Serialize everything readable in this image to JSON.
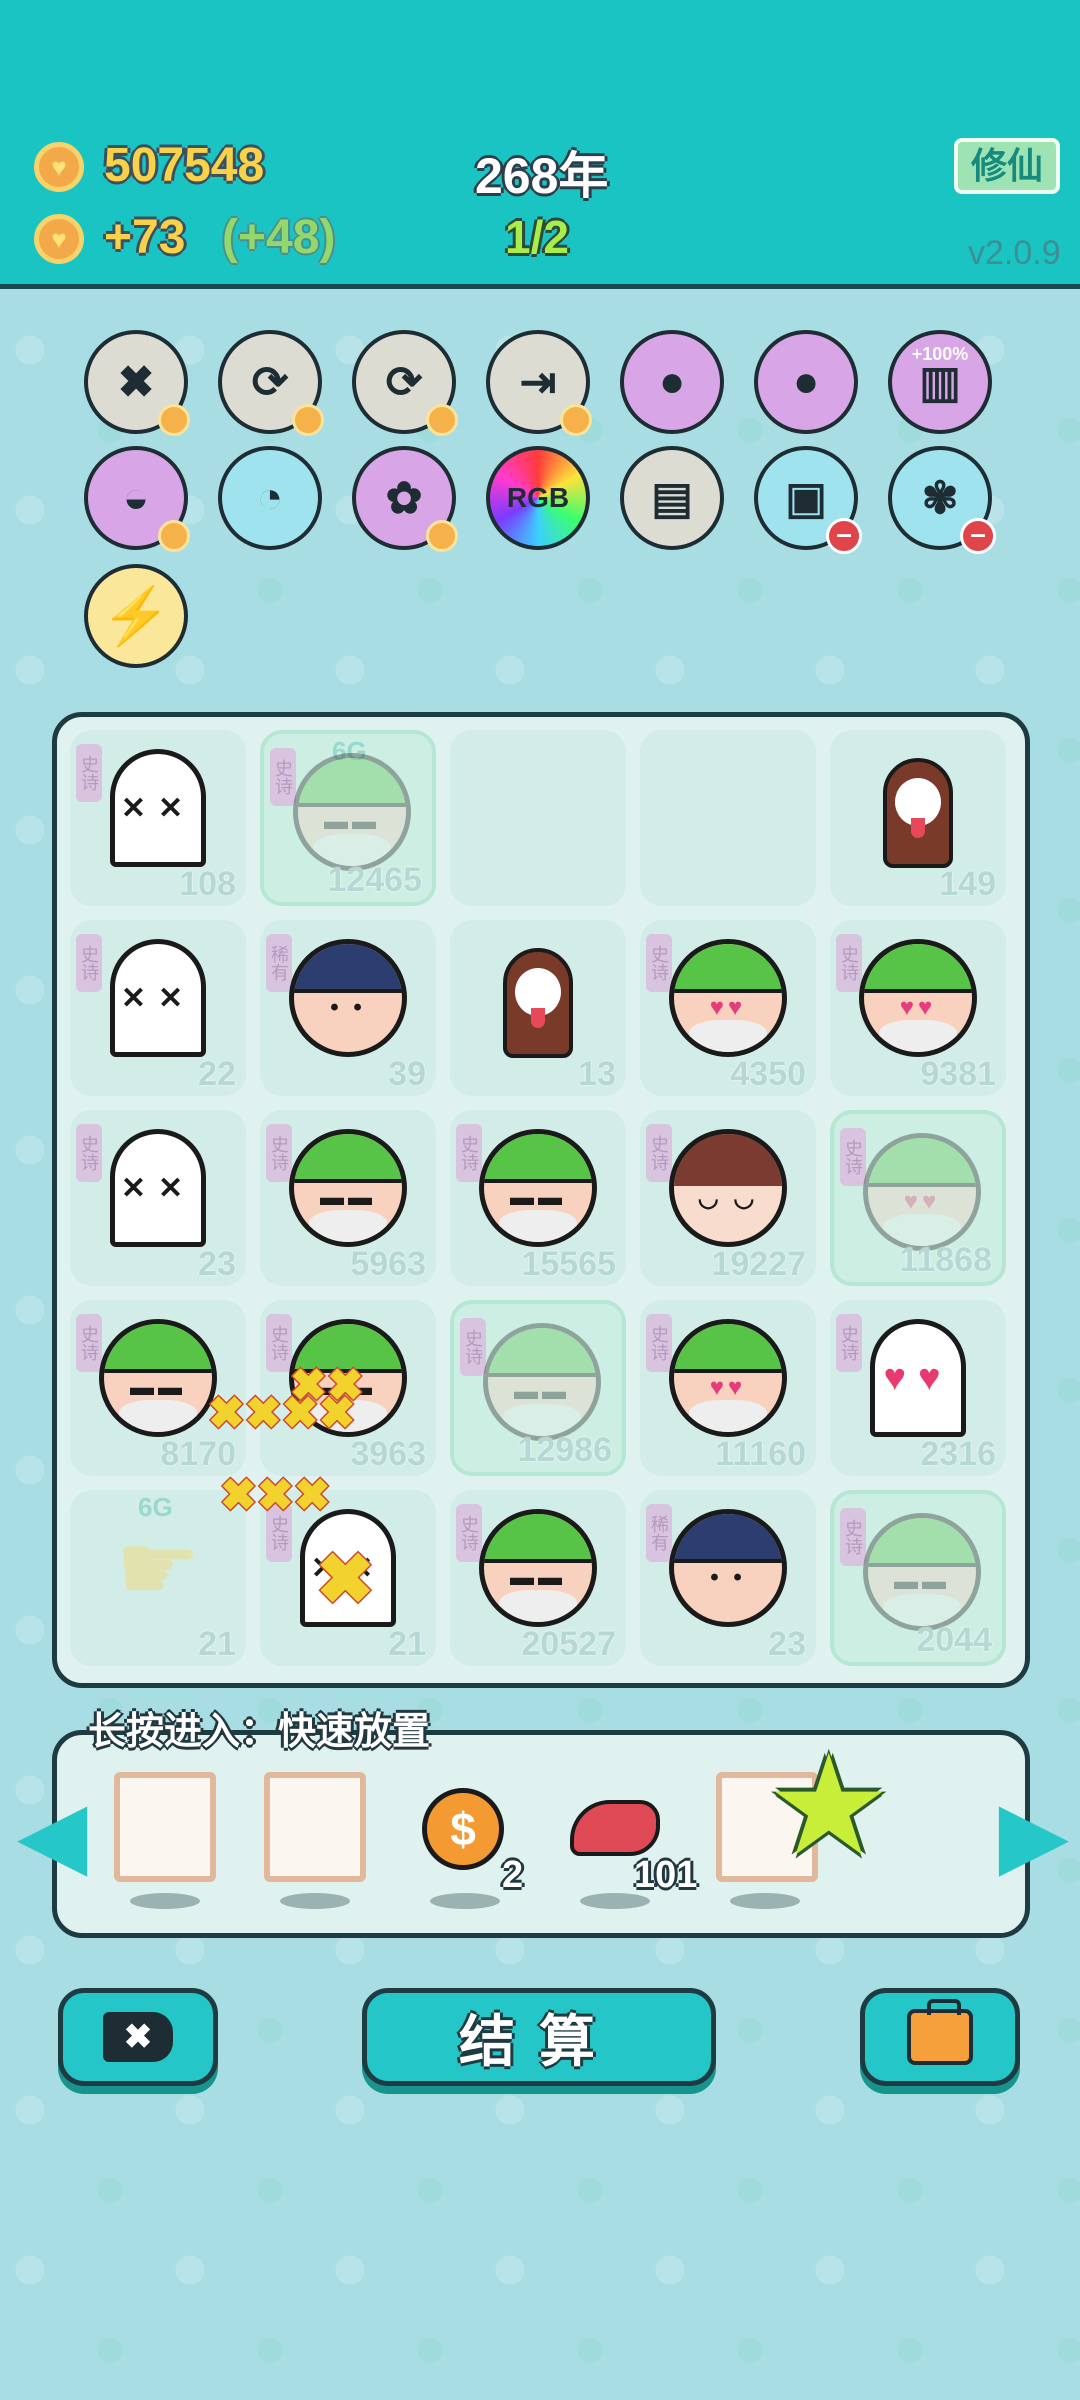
{
  "header": {
    "coins": "507548",
    "income": "+73",
    "income_bonus": "(+48)",
    "year": "268年",
    "page": "1/2",
    "xiuxian_label": "修仙",
    "version": "v2.0.9"
  },
  "buffs": {
    "row1": [
      {
        "name": "tag-remove-icon",
        "bg": "#dcdcd2",
        "symbol": "✖"
      },
      {
        "name": "refresh-icon",
        "bg": "#dcdcd2",
        "symbol": "⟳"
      },
      {
        "name": "refresh-icon-2",
        "bg": "#dcdcd2",
        "symbol": "⟳"
      },
      {
        "name": "skip-icon",
        "bg": "#dcdcd2",
        "symbol": "⇥"
      },
      {
        "name": "eyepatch-coin-icon",
        "bg": "#d8a6e6",
        "symbol": "●"
      },
      {
        "name": "eyepatch-coin-icon-2",
        "bg": "#d8a6e6",
        "symbol": "●"
      },
      {
        "name": "bucket-icon",
        "bg": "#d8a6e6",
        "symbol": "▥",
        "label": "+100%"
      }
    ],
    "row2": [
      {
        "name": "rice-bowl-icon",
        "bg": "#d8a6e6",
        "symbol": "◒"
      },
      {
        "name": "chick-egg-icon",
        "bg": "#9fe3ee",
        "symbol": "◔"
      },
      {
        "name": "rabbit-icon",
        "bg": "#d8a6e6",
        "symbol": "✿"
      },
      {
        "name": "rgb-icon",
        "bg": "#ff4d6d",
        "symbol": "RGB"
      },
      {
        "name": "bubble-tea-icon",
        "bg": "#dcdcd2",
        "symbol": "▤"
      },
      {
        "name": "money-bag-icon",
        "bg": "#9fe3ee",
        "symbol": "▣"
      },
      {
        "name": "flower-pot-icon",
        "bg": "#9fe3ee",
        "symbol": "✾"
      }
    ],
    "row3": [
      {
        "name": "lightning-icon",
        "bg": "#fbe79a",
        "symbol": "⚡"
      }
    ]
  },
  "board": {
    "cells": [
      {
        "kind": "ghost",
        "num": "108",
        "tag": "史诗"
      },
      {
        "kind": "face-green",
        "num": "12465",
        "tag": "史诗",
        "faded": true,
        "gtag": "6G"
      },
      {
        "kind": "empty",
        "num": ""
      },
      {
        "kind": "empty",
        "num": ""
      },
      {
        "kind": "dog",
        "num": "149"
      },
      {
        "kind": "ghost",
        "num": "22",
        "tag": "史诗"
      },
      {
        "kind": "police",
        "num": "39",
        "tag": "稀有"
      },
      {
        "kind": "dog",
        "num": "13"
      },
      {
        "kind": "face-hearts",
        "num": "4350",
        "tag": "史诗"
      },
      {
        "kind": "face-hearts",
        "num": "9381",
        "tag": "史诗"
      },
      {
        "kind": "ghost",
        "num": "23",
        "tag": "史诗"
      },
      {
        "kind": "face-green",
        "num": "5963",
        "tag": "史诗"
      },
      {
        "kind": "face-green",
        "num": "15565",
        "tag": "史诗"
      },
      {
        "kind": "girl",
        "num": "19227",
        "tag": "史诗"
      },
      {
        "kind": "face-hearts",
        "num": "11868",
        "tag": "史诗",
        "faded": true
      },
      {
        "kind": "face-green",
        "num": "8170",
        "tag": "史诗"
      },
      {
        "kind": "face-green",
        "num": "3963",
        "tag": "史诗"
      },
      {
        "kind": "face-green",
        "num": "12986",
        "tag": "史诗",
        "faded": true
      },
      {
        "kind": "face-hearts",
        "num": "11160",
        "tag": "史诗"
      },
      {
        "kind": "ghost-hearts",
        "num": "2316",
        "tag": "史诗"
      },
      {
        "kind": "hand",
        "num": "21",
        "gtag": "6G"
      },
      {
        "kind": "ghost",
        "num": "21",
        "tag": "史诗"
      },
      {
        "kind": "face-green",
        "num": "20527",
        "tag": "史诗"
      },
      {
        "kind": "police",
        "num": "23",
        "tag": "稀有"
      },
      {
        "kind": "face-green",
        "num": "2044",
        "tag": "史诗",
        "faded": true
      }
    ]
  },
  "tray": {
    "title": "长按进入：快速放置",
    "coin_count": "2",
    "liver_count": "101"
  },
  "buttons": {
    "settle_label": "结算"
  },
  "colors": {
    "header_bg": "#19c4c3",
    "board_bg": "#dff2ef",
    "accent": "#24c6c8"
  }
}
